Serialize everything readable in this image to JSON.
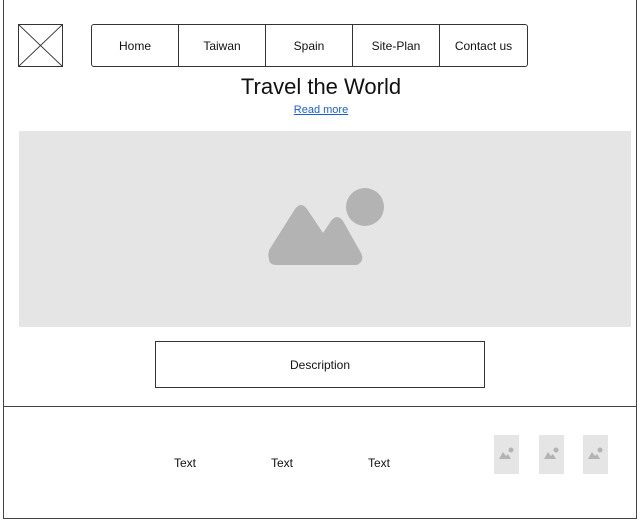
{
  "nav": {
    "items": [
      {
        "label": "Home"
      },
      {
        "label": "Taiwan"
      },
      {
        "label": "Spain"
      },
      {
        "label": "Site-Plan"
      },
      {
        "label": "Contact us"
      }
    ]
  },
  "main": {
    "title": "Travel the World",
    "read_more": "Read more",
    "description": "Description"
  },
  "footer": {
    "texts": [
      "Text",
      "Text",
      "Text"
    ]
  },
  "icons": {
    "logo": "placeholder-x-icon",
    "hero": "image-placeholder-icon",
    "thumbnails": [
      "image-placeholder-icon",
      "image-placeholder-icon",
      "image-placeholder-icon"
    ]
  },
  "colors": {
    "placeholder_bg": "#e5e5e5",
    "placeholder_icon": "#b3b3b3",
    "link": "#1a5fd0"
  }
}
